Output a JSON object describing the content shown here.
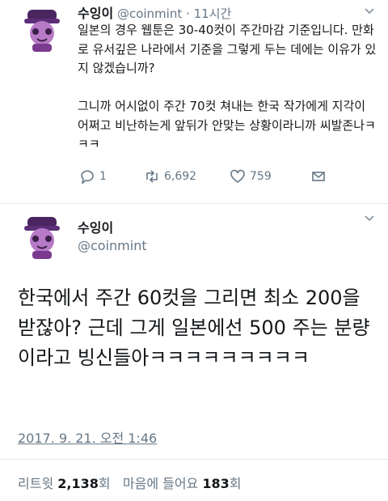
{
  "tweet1": {
    "name": "수잉이",
    "handle": "@coinmint",
    "dot": "·",
    "time": "11시간",
    "text": "일본의 경우 웹툰은 30-40컷이 주간마감 기준입니다. 만화로 유서깊은 나라에서 기준을 그렇게 두는 데에는 이유가 있지 않겠습니까?\n\n그니까 어시없이 주간 70컷 쳐내는 한국 작가에게 지각이 어쩌고 비난하는게 앞뒤가 안맞는 상황이라니까 씨발존나ㅋㅋㅋ",
    "replies": "1",
    "retweets": "6,692",
    "likes": "759"
  },
  "tweet2": {
    "name": "수잉이",
    "handle": "@coinmint",
    "text": "한국에서 주간 60컷을 그리면 최소 200을 받잖아? 근데 그게 일본에선 500 주는 분량이라고 빙신들아ㅋㅋㅋㅋㅋㅋㅋㅋㅋ",
    "timestamp": "2017. 9. 21. 오전 1:46",
    "retweets_label": "리트윗",
    "retweets_count": "2,138",
    "retweets_unit": "회",
    "likes_label": "마음에 들어요",
    "likes_count": "183",
    "likes_unit": "회"
  },
  "colors": {
    "muted": "#657786",
    "text": "#14171a",
    "divider": "#e1e8ed",
    "avatar_accent": "#7a3b8f"
  },
  "icons": [
    "chevron-down-icon",
    "reply-icon",
    "retweet-icon",
    "like-icon",
    "share-icon"
  ]
}
